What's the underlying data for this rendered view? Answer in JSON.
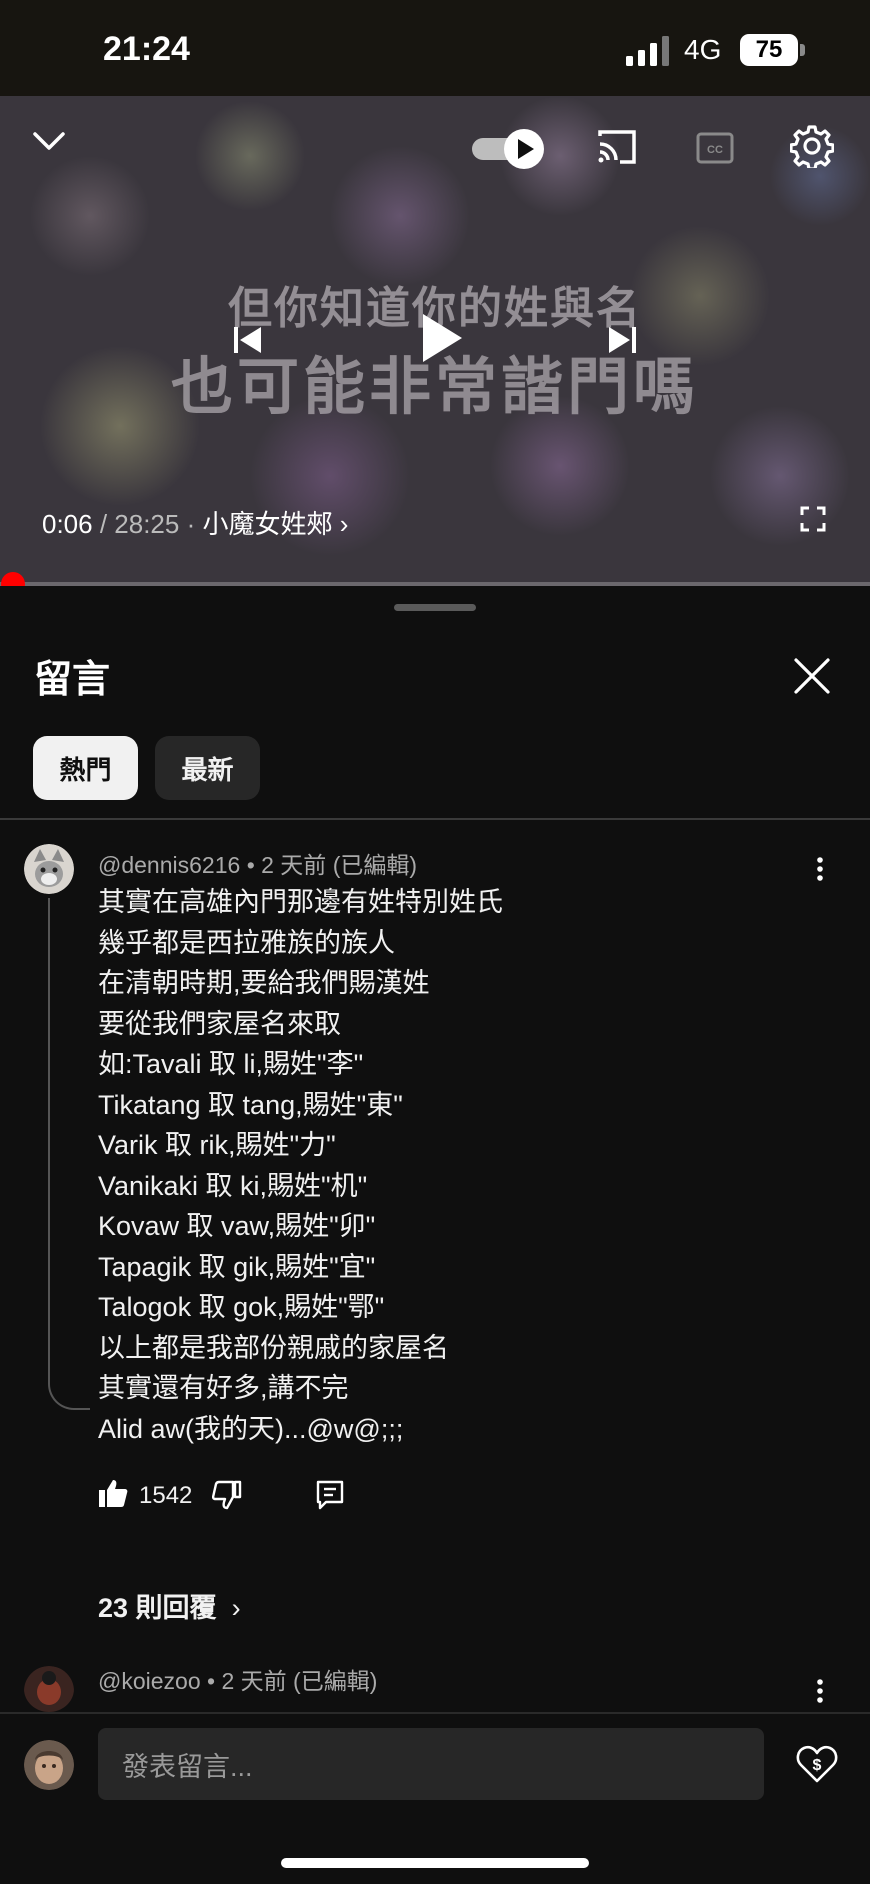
{
  "status_bar": {
    "time": "21:24",
    "network": "4G",
    "battery": "75"
  },
  "video": {
    "lyric_line1": "但你知道你的姓與名",
    "lyric_line2": "也可能非常諧門嗎",
    "time_current": "0:06",
    "time_total": "/ 28:25",
    "separator": "·",
    "chapter": "小魔女姓郟",
    "progress_fraction": 0.0035,
    "autoplay_on": true
  },
  "comments_sheet": {
    "title": "留言",
    "tabs": [
      {
        "label": "熱門",
        "selected": true
      },
      {
        "label": "最新",
        "selected": false
      }
    ],
    "comments": [
      {
        "author": "@dennis6216",
        "meta": "• 2 天前 (已編輯)",
        "lines": [
          "其實在高雄內門那邊有姓特別姓氏",
          "幾乎都是西拉雅族的族人",
          "在清朝時期,要給我們賜漢姓",
          "要從我們家屋名來取",
          "如:Tavali 取 li,賜姓\"李\"",
          "Tikatang 取 tang,賜姓\"東\"",
          "Varik 取 rik,賜姓\"力\"",
          "Vanikaki 取 ki,賜姓\"机\"",
          "Kovaw 取 vaw,賜姓\"卯\"",
          "Tapagik 取 gik,賜姓\"宜\"",
          "Talogok 取 gok,賜姓\"鄂\"",
          "以上都是我部份親戚的家屋名",
          "其實還有好多,講不完",
          "Alid aw(我的天)...@w@;;;"
        ],
        "likes": "1542",
        "replies_label": "23 則回覆"
      },
      {
        "author": "@koiezoo",
        "meta": "• 2 天前 (已編輯)"
      }
    ],
    "input_placeholder": "發表留言..."
  },
  "colors": {
    "accent_red": "#ff0000",
    "background": "#0f0f0f",
    "chip_selected": "#f1f1f1",
    "chip": "#272727"
  }
}
